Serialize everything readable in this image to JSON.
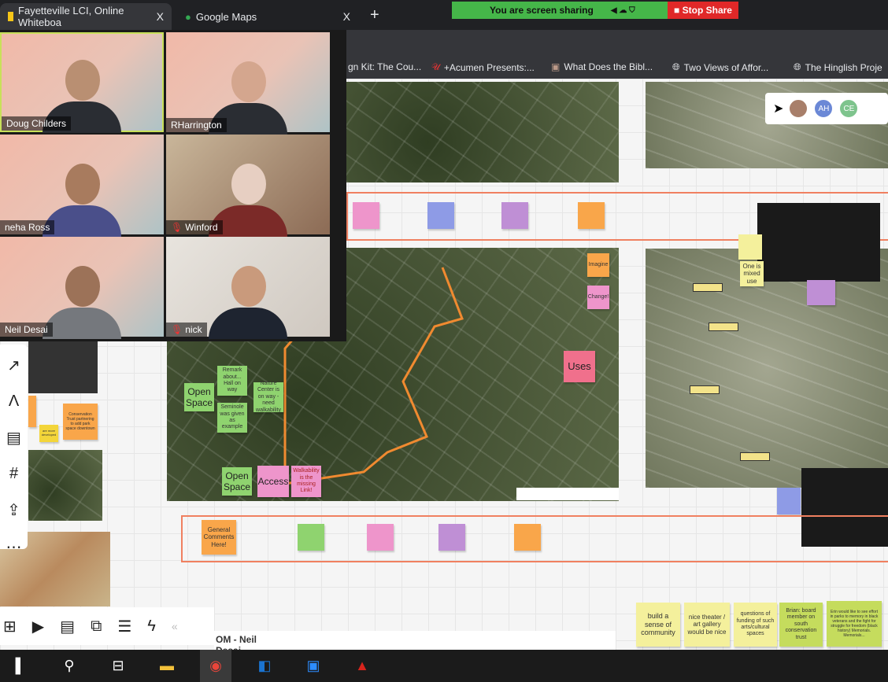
{
  "browser": {
    "tabs": [
      {
        "title": "Fayetteville LCI, Online Whiteboa",
        "active": true
      },
      {
        "title": "Google Maps",
        "active": false
      }
    ],
    "new_tab": "+",
    "close": "X",
    "bookmarks": [
      "gn Kit: The Cou...",
      "+Acumen Presents:...",
      "What Does the Bibl...",
      "Two Views of Affor...",
      "The Hinglish Proje"
    ]
  },
  "zoom_share": {
    "status": "You are screen sharing",
    "stop_label": "Stop Share"
  },
  "participants": [
    {
      "name": "Doug Childers",
      "muted": false,
      "active": true
    },
    {
      "name": "RHarrington",
      "muted": false
    },
    {
      "name": "neha Ross",
      "muted": false
    },
    {
      "name": "Winford",
      "muted": true
    },
    {
      "name": "Neil Desai",
      "muted": false
    },
    {
      "name": "nick",
      "muted": true
    }
  ],
  "board": {
    "map_stickies": {
      "open_space_1": "Open Space",
      "note_1": "Remark about... Hall on way",
      "note_2": "Nature Center is on way - need walkability",
      "note_3": "Seminole was given as example",
      "open_space_2": "Open Space",
      "access": "Access",
      "walkability": "Walkability is the missing Link!",
      "imagine": "Imagine",
      "change": "Change!",
      "uses": "Uses"
    },
    "general_comments": "General Comments Here!",
    "left_stickies": {
      "conservation": "Conservation Trust partnering to add park space downtown",
      "small": "are more developed"
    },
    "mixed_use": "One is mixed use",
    "bottom_stickies": [
      "build a sense of community",
      "nice theater / art gallery would be nice",
      "questions of funding of such arts/cultural spaces",
      "Brian: board member on south conservation trust",
      "Erin would like to see effort in parks to memory in black veterans and the fight for struggle for freedom (black history) Memorials. Memorials..."
    ],
    "presenter_label": "OM - Neil Desai",
    "avatars": [
      "AH",
      "CE"
    ]
  },
  "colors": {
    "share_green": "#45b649",
    "stop_red": "#e02828",
    "frame_orange": "#f08060"
  }
}
